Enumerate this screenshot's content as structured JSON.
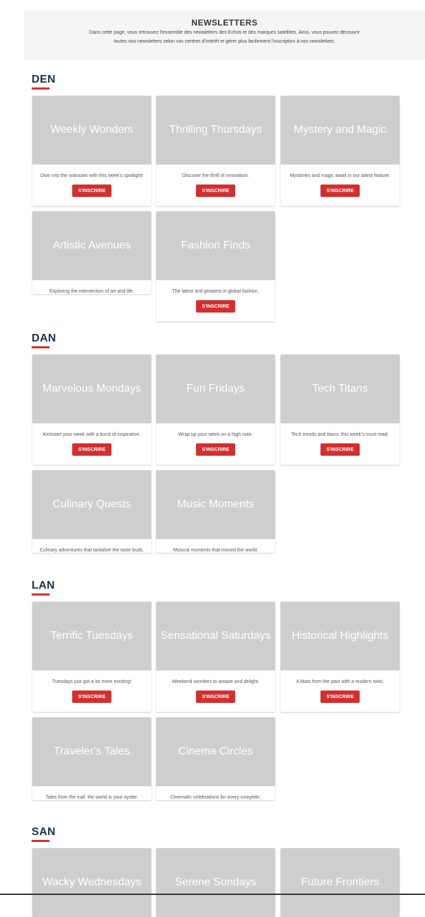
{
  "header": {
    "title": "NEWSLETTERS",
    "description": "Dans cette page, vous retrouvez l'ensemble des newsletters des Echos et des marques satellites. Ainsi, vous pouvez découvrir toutes nos newsletters selon vos centres d'intérêt et gérer plus facilement l'inscription à vos newsletters."
  },
  "sections": [
    {
      "title": "DEN",
      "cards": [
        {
          "title": "Weekly Wonders",
          "description": "Dive into the unknown with this week's spotlight!",
          "button": "S'INSCRIRE"
        },
        {
          "title": "Thrilling Thursdays",
          "description": "Discover the thrill of innovation.",
          "button": "S'INSCRIRE"
        },
        {
          "title": "Mystery and Magic",
          "description": "Mysteries and magic await in our latest feature.",
          "button": "S'INSCRIRE"
        },
        {
          "title": "Artistic Avenues",
          "description": "Exploring the intersection of art and life."
        },
        {
          "title": "Fashion Finds",
          "description": "The latest and greatest in global fashion.",
          "button": "S'INSCRIRE"
        }
      ]
    },
    {
      "title": "DAN",
      "cards": [
        {
          "title": "Marvelous Mondays",
          "description": "Kickstart your week with a burst of inspiration.",
          "button": "S'INSCRIRE"
        },
        {
          "title": "Fun Fridays",
          "description": "Wrap up your week on a high note.",
          "button": "S'INSCRIRE"
        },
        {
          "title": "Tech Titans",
          "description": "Tech trends and titans: this week's must-read.",
          "button": "S'INSCRIRE"
        },
        {
          "title": "Culinary Quests",
          "description": "Culinary adventures that tantalize the taste buds."
        },
        {
          "title": "Music Moments",
          "description": "Musical moments that moved the world."
        }
      ]
    },
    {
      "title": "LAN",
      "cards": [
        {
          "title": "Terrific Tuesdays",
          "description": "Tuesdays just got a lot more exciting!",
          "button": "S'INSCRIRE"
        },
        {
          "title": "Sensational Saturdays",
          "description": "Weekend wonders to amaze and delight.",
          "button": "S'INSCRIRE"
        },
        {
          "title": "Historical Highlights",
          "description": "A blast from the past with a modern twist.",
          "button": "S'INSCRIRE"
        },
        {
          "title": "Traveler's Tales",
          "description": "Tales from the trail: the world is your oyster."
        },
        {
          "title": "Cinema Circles",
          "description": "Cinematic celebrations for every cinephile."
        }
      ]
    },
    {
      "title": "SAN",
      "cards": [
        {
          "title": "Wacky Wednesdays"
        },
        {
          "title": "Serene Sundays"
        },
        {
          "title": "Future Frontiers"
        }
      ]
    }
  ]
}
